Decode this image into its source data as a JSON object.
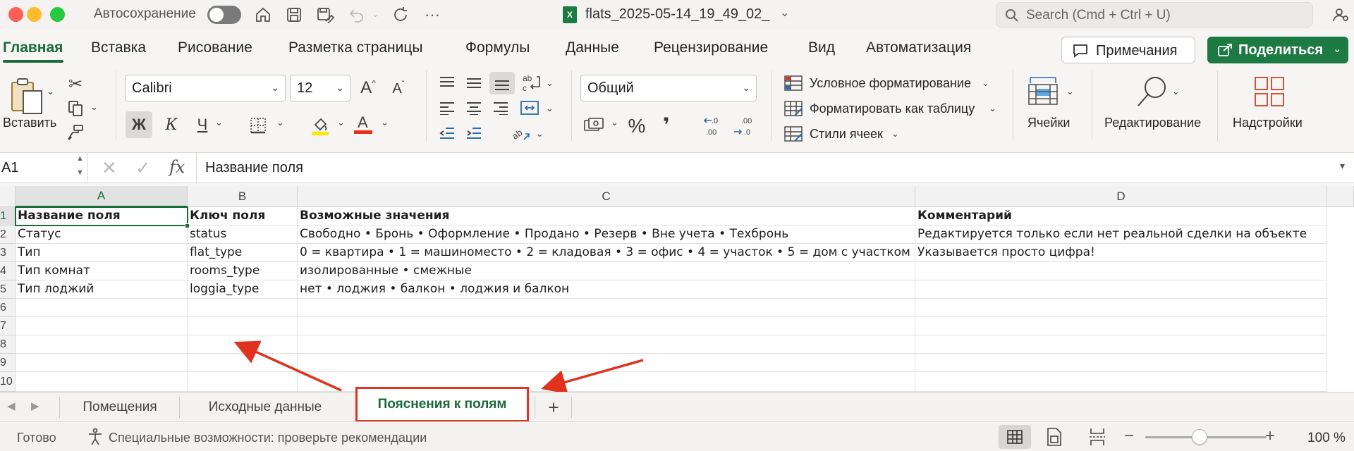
{
  "titlebar": {
    "autosave_label": "Автосохранение",
    "filename": "flats_2025-05-14_19_49_02_",
    "search_placeholder": "Search (Cmd + Ctrl + U)"
  },
  "ribbon_tabs": [
    "Главная",
    "Вставка",
    "Рисование",
    "Разметка страницы",
    "Формулы",
    "Данные",
    "Рецензирование",
    "Вид",
    "Автоматизация"
  ],
  "active_ribbon_tab": "Главная",
  "header_buttons": {
    "comments": "Примечания",
    "share": "Поделиться"
  },
  "ribbon": {
    "paste_label": "Вставить",
    "font_name": "Calibri",
    "font_size": "12",
    "bold": "Ж",
    "italic": "К",
    "underline": "Ч",
    "number_format": "Общий",
    "conditional_formatting": "Условное форматирование",
    "format_as_table": "Форматировать как таблицу",
    "cell_styles": "Стили ячеек",
    "cells_label": "Ячейки",
    "editing_label": "Редактирование",
    "addins_label": "Надстройки",
    "percent": "%",
    "comma": "❜",
    "dec_increase": ".00",
    "dec_decrease": ".00"
  },
  "formula_bar": {
    "name_box": "A1",
    "fx": "fx",
    "formula": "Название поля"
  },
  "grid": {
    "columns": [
      "A",
      "B",
      "C",
      "D"
    ],
    "row_numbers": [
      "1",
      "2",
      "3",
      "4",
      "5",
      "6",
      "7",
      "8",
      "9",
      "10"
    ],
    "rows": [
      [
        "Название поля",
        "Ключ поля",
        "Возможные значения",
        "Комментарий"
      ],
      [
        "Статус",
        "status",
        "Свободно • Бронь • Оформление • Продано • Резерв • Вне учета • Техбронь",
        "Редактируется только если нет реальной сделки на объекте"
      ],
      [
        "Тип",
        "flat_type",
        "0 = квартира • 1 = машиноместо • 2 = кладовая • 3 = офис • 4 = участок • 5 = дом с участком",
        "Указывается просто цифра!"
      ],
      [
        "Тип комнат",
        "rooms_type",
        "изолированные • смежные",
        ""
      ],
      [
        "Тип лоджий",
        "loggia_type",
        "нет • лоджия • балкон • лоджия и балкон",
        ""
      ]
    ]
  },
  "sheet_tabs": [
    "Помещения",
    "Исходные данные",
    "Пояснения к полям"
  ],
  "active_sheet": "Пояснения к полям",
  "add_sheet": "+",
  "statusbar": {
    "ready": "Готово",
    "accessibility": "Специальные возможности: проверьте рекомендации",
    "zoom_minus": "−",
    "zoom_plus": "+",
    "zoom": "100 %"
  },
  "colors": {
    "accent_green": "#1a6b39",
    "share_green": "#1e7a43",
    "annotation_red": "#e0321d"
  }
}
